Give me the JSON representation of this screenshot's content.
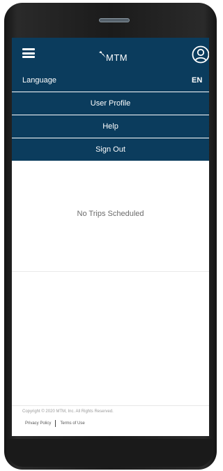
{
  "header": {
    "logo_text": "MTM",
    "menu_icon": "hamburger-menu-icon",
    "user_icon": "user-profile-icon",
    "header_color": "#0b3c5d"
  },
  "language": {
    "label": "Language",
    "value": "EN"
  },
  "menu": {
    "items": [
      {
        "label": "User Profile"
      },
      {
        "label": "Help"
      },
      {
        "label": "Sign Out"
      }
    ]
  },
  "main": {
    "empty_message": "No Trips Scheduled"
  },
  "footer": {
    "copyright": "Copyright © 2020 MTM, Inc. All Rights Reserved.",
    "privacy_link": "Privacy Policy",
    "terms_link": "Terms of Use"
  }
}
